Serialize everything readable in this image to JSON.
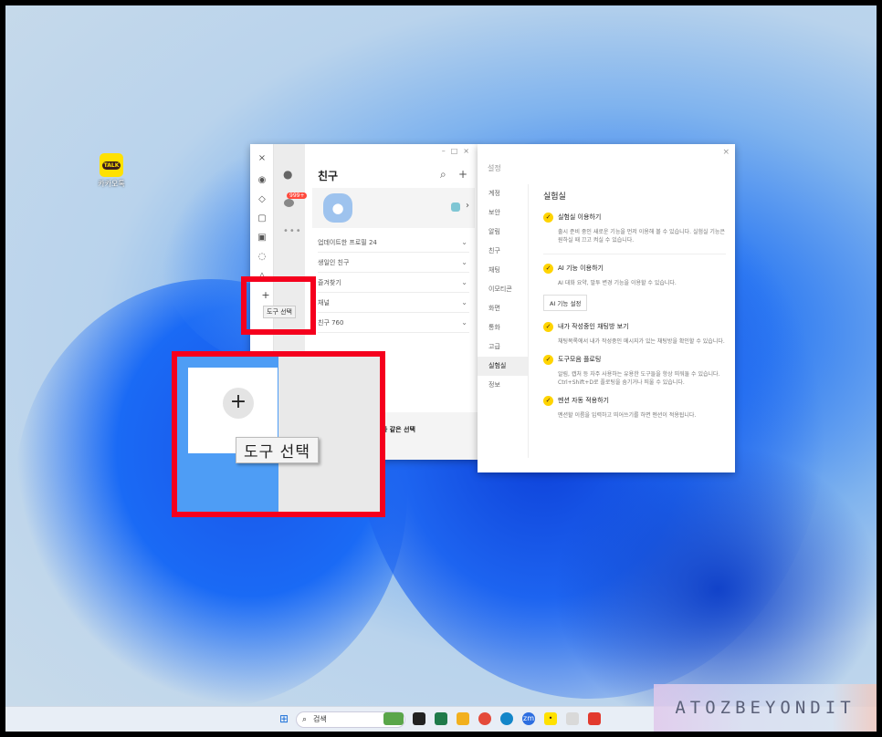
{
  "desktop": {
    "icon_label": "카카오톡",
    "icon_badge": "TALK"
  },
  "kakao": {
    "rail_close": "×",
    "friends_title": "친구",
    "unread_badge": "999+",
    "profile_chevron": "›",
    "sections": [
      {
        "label": "업데이트한 프로필  24"
      },
      {
        "label": "생일인 친구"
      },
      {
        "label": "즐겨찾기"
      },
      {
        "label": "채널"
      },
      {
        "label": "친구  760"
      }
    ],
    "banner_title": "은 통증, 다 같은 선택",
    "banner_sub": "별",
    "tool_tip": "도구 선택"
  },
  "settings": {
    "title": "설정",
    "close": "×",
    "nav": [
      "계정",
      "보안",
      "알림",
      "친구",
      "채팅",
      "이모티콘",
      "화면",
      "통화",
      "고급",
      "실험실",
      "정보"
    ],
    "active_nav": "실험실",
    "heading": "실험실",
    "options": [
      {
        "label": "실험실 이용하기",
        "desc": "출시 준비 중인 새로운 기능을 먼저 이용해 볼 수 있습니다. 실험실 기능은 원하실 때 끄고 켜실 수 있습니다."
      },
      {
        "label": "AI 기능 이용하기",
        "desc": "AI 대화 요약, 말투 변경 기능을 이용할 수 있습니다.",
        "button": "AI 기능 설정"
      },
      {
        "label": "내가 작성중인 채팅방 보기",
        "desc": "채팅목록에서 내가 작성중인 메시지가 있는 채팅방을 확인할 수 있습니다."
      },
      {
        "label": "도구모음 플로팅",
        "desc": "알림, 캡처 등 자주 사용하는 유용한 도구들을 항상 띄워둘 수 있습니다. Ctrl+Shift+D로 플로팅을 숨기거나 띄울 수 있습니다."
      },
      {
        "label": "멘션 자동 적용하기",
        "desc": "멘션할 이름을 입력하고 띄어쓰기를 하면 멘션이 적용됩니다."
      }
    ]
  },
  "zoom": {
    "plus": "+",
    "tooltip": "도구 선택"
  },
  "taskbar": {
    "search_label": "검색"
  },
  "watermark": "ATOZBEYONDIT"
}
